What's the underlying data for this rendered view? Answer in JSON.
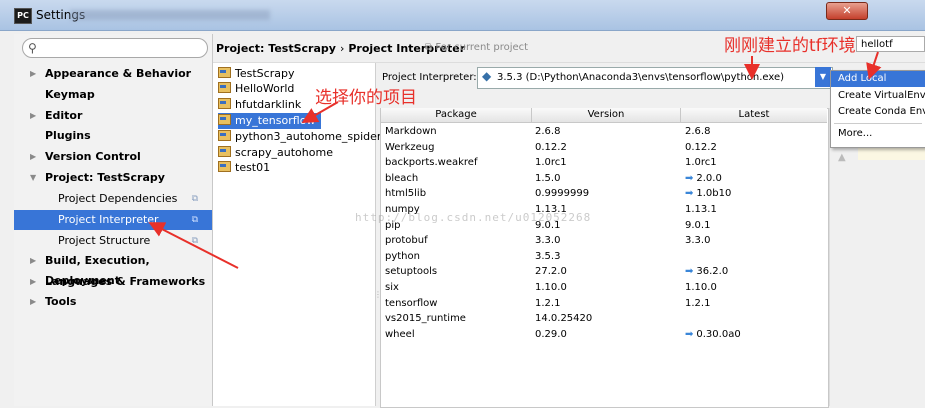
{
  "window": {
    "title": "Settings",
    "app_icon_text": "PC",
    "close_glyph": "✕"
  },
  "search": {
    "placeholder": ""
  },
  "sidebar": {
    "items": [
      {
        "label": "Appearance & Behavior",
        "bold": true,
        "arrow": "▶"
      },
      {
        "label": "Keymap",
        "bold": true,
        "arrow": ""
      },
      {
        "label": "Editor",
        "bold": true,
        "arrow": "▶"
      },
      {
        "label": "Plugins",
        "bold": true,
        "arrow": ""
      },
      {
        "label": "Version Control",
        "bold": true,
        "arrow": "▶"
      },
      {
        "label": "Project: TestScrapy",
        "bold": true,
        "arrow": "▼"
      },
      {
        "label": "Project Dependencies",
        "bold": false,
        "arrow": ""
      },
      {
        "label": "Project Interpreter",
        "bold": false,
        "arrow": "",
        "selected": true
      },
      {
        "label": "Project Structure",
        "bold": false,
        "arrow": ""
      },
      {
        "label": "Build, Execution, Deployment",
        "bold": true,
        "arrow": "▶"
      },
      {
        "label": "Languages & Frameworks",
        "bold": true,
        "arrow": "▶"
      },
      {
        "label": "Tools",
        "bold": true,
        "arrow": "▶"
      }
    ]
  },
  "header": {
    "project": "Project: TestScrapy",
    "separator": "›",
    "page": "Project Interpreter",
    "note": "For current project"
  },
  "projects": [
    "TestScrapy",
    "HelloWorld",
    "hfutdarklink",
    "my_tensorflow",
    "python3_autohome_spider",
    "scrapy_autohome",
    "test01"
  ],
  "interpreter": {
    "label": "Project Interpreter:",
    "value": "3.5.3 (D:\\Python\\Anaconda3\\envs\\tensorflow\\python.exe)"
  },
  "table": {
    "headers": [
      "Package",
      "Version",
      "Latest"
    ],
    "rows": [
      {
        "package": "Markdown",
        "version": "2.6.8",
        "latest": "2.6.8",
        "upgrade": false
      },
      {
        "package": "Werkzeug",
        "version": "0.12.2",
        "latest": "0.12.2",
        "upgrade": false
      },
      {
        "package": "backports.weakref",
        "version": "1.0rc1",
        "latest": "1.0rc1",
        "upgrade": false
      },
      {
        "package": "bleach",
        "version": "1.5.0",
        "latest": "2.0.0",
        "upgrade": true
      },
      {
        "package": "html5lib",
        "version": "0.9999999",
        "latest": "1.0b10",
        "upgrade": true
      },
      {
        "package": "numpy",
        "version": "1.13.1",
        "latest": "1.13.1",
        "upgrade": false
      },
      {
        "package": "pip",
        "version": "9.0.1",
        "latest": "9.0.1",
        "upgrade": false
      },
      {
        "package": "protobuf",
        "version": "3.3.0",
        "latest": "3.3.0",
        "upgrade": false
      },
      {
        "package": "python",
        "version": "3.5.3",
        "latest": "",
        "upgrade": false
      },
      {
        "package": "setuptools",
        "version": "27.2.0",
        "latest": "36.2.0",
        "upgrade": true
      },
      {
        "package": "six",
        "version": "1.10.0",
        "latest": "1.10.0",
        "upgrade": false
      },
      {
        "package": "tensorflow",
        "version": "1.2.1",
        "latest": "1.2.1",
        "upgrade": false
      },
      {
        "package": "vs2015_runtime",
        "version": "14.0.25420",
        "latest": "",
        "upgrade": false
      },
      {
        "package": "wheel",
        "version": "0.29.0",
        "latest": "0.30.0a0",
        "upgrade": true
      }
    ]
  },
  "popup": {
    "items": [
      "Add Local",
      "Create VirtualEnv",
      "Create Conda Env",
      "More..."
    ]
  },
  "behind_tab": "hellotf",
  "annotations": {
    "choose_project": "选择你的项目",
    "tf_env": "刚刚建立的tf环境"
  },
  "watermark": "http://blog.csdn.net/u012052268",
  "colors": {
    "selection": "#3875d7",
    "annotation": "#e8302a",
    "upgrade_arrow": "#3a86d8"
  }
}
